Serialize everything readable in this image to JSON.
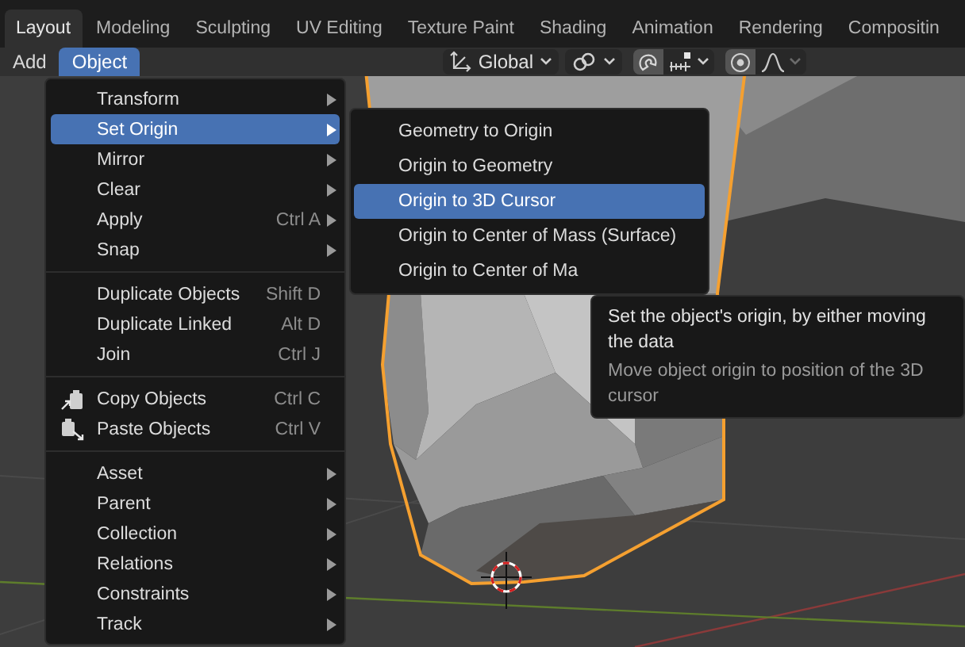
{
  "tabs": [
    {
      "label": "Layout",
      "selected": true
    },
    {
      "label": "Modeling",
      "selected": false
    },
    {
      "label": "Sculpting",
      "selected": false
    },
    {
      "label": "UV Editing",
      "selected": false
    },
    {
      "label": "Texture Paint",
      "selected": false
    },
    {
      "label": "Shading",
      "selected": false
    },
    {
      "label": "Animation",
      "selected": false
    },
    {
      "label": "Rendering",
      "selected": false
    },
    {
      "label": "Compositin",
      "selected": false
    }
  ],
  "header": {
    "menus": [
      {
        "label": "Add",
        "selected": false
      },
      {
        "label": "Object",
        "selected": true
      }
    ],
    "orientation": {
      "value": "Global"
    },
    "snapping": {
      "on": true
    },
    "proportional_editing": {
      "on": true
    }
  },
  "object_menu": {
    "items": [
      {
        "kind": "submenu",
        "label": "Transform",
        "selected": false
      },
      {
        "kind": "submenu",
        "label": "Set Origin",
        "selected": true
      },
      {
        "kind": "submenu",
        "label": "Mirror",
        "selected": false
      },
      {
        "kind": "submenu",
        "label": "Clear",
        "selected": false
      },
      {
        "kind": "submenu",
        "label": "Apply",
        "shortcut": "Ctrl A",
        "selected": false
      },
      {
        "kind": "submenu",
        "label": "Snap",
        "selected": false
      },
      {
        "kind": "separator"
      },
      {
        "kind": "command",
        "label": "Duplicate Objects",
        "shortcut": "Shift D",
        "selected": false
      },
      {
        "kind": "command",
        "label": "Duplicate Linked",
        "shortcut": "Alt D",
        "selected": false
      },
      {
        "kind": "command",
        "label": "Join",
        "shortcut": "Ctrl J",
        "selected": false
      },
      {
        "kind": "separator"
      },
      {
        "kind": "copy",
        "label": "Copy Objects",
        "shortcut": "Ctrl C",
        "selected": false
      },
      {
        "kind": "paste",
        "label": "Paste Objects",
        "shortcut": "Ctrl V",
        "selected": false
      },
      {
        "kind": "separator"
      },
      {
        "kind": "submenu",
        "label": "Asset",
        "selected": false
      },
      {
        "kind": "submenu",
        "label": "Parent",
        "selected": false
      },
      {
        "kind": "submenu",
        "label": "Collection",
        "selected": false
      },
      {
        "kind": "submenu",
        "label": "Relations",
        "selected": false
      },
      {
        "kind": "submenu",
        "label": "Constraints",
        "selected": false
      },
      {
        "kind": "submenu",
        "label": "Track",
        "selected": false
      }
    ]
  },
  "set_origin_menu": {
    "items": [
      {
        "label": "Geometry to Origin",
        "selected": false
      },
      {
        "label": "Origin to Geometry",
        "selected": false
      },
      {
        "label": "Origin to 3D Cursor",
        "selected": true
      },
      {
        "label": "Origin to Center of Mass (Surface)",
        "selected": false
      },
      {
        "label": "Origin to Center of Ma",
        "selected": false
      }
    ]
  },
  "tooltip": {
    "title": "Set the object's origin, by either moving the data",
    "description": "Move object origin to position of the 3D cursor"
  }
}
